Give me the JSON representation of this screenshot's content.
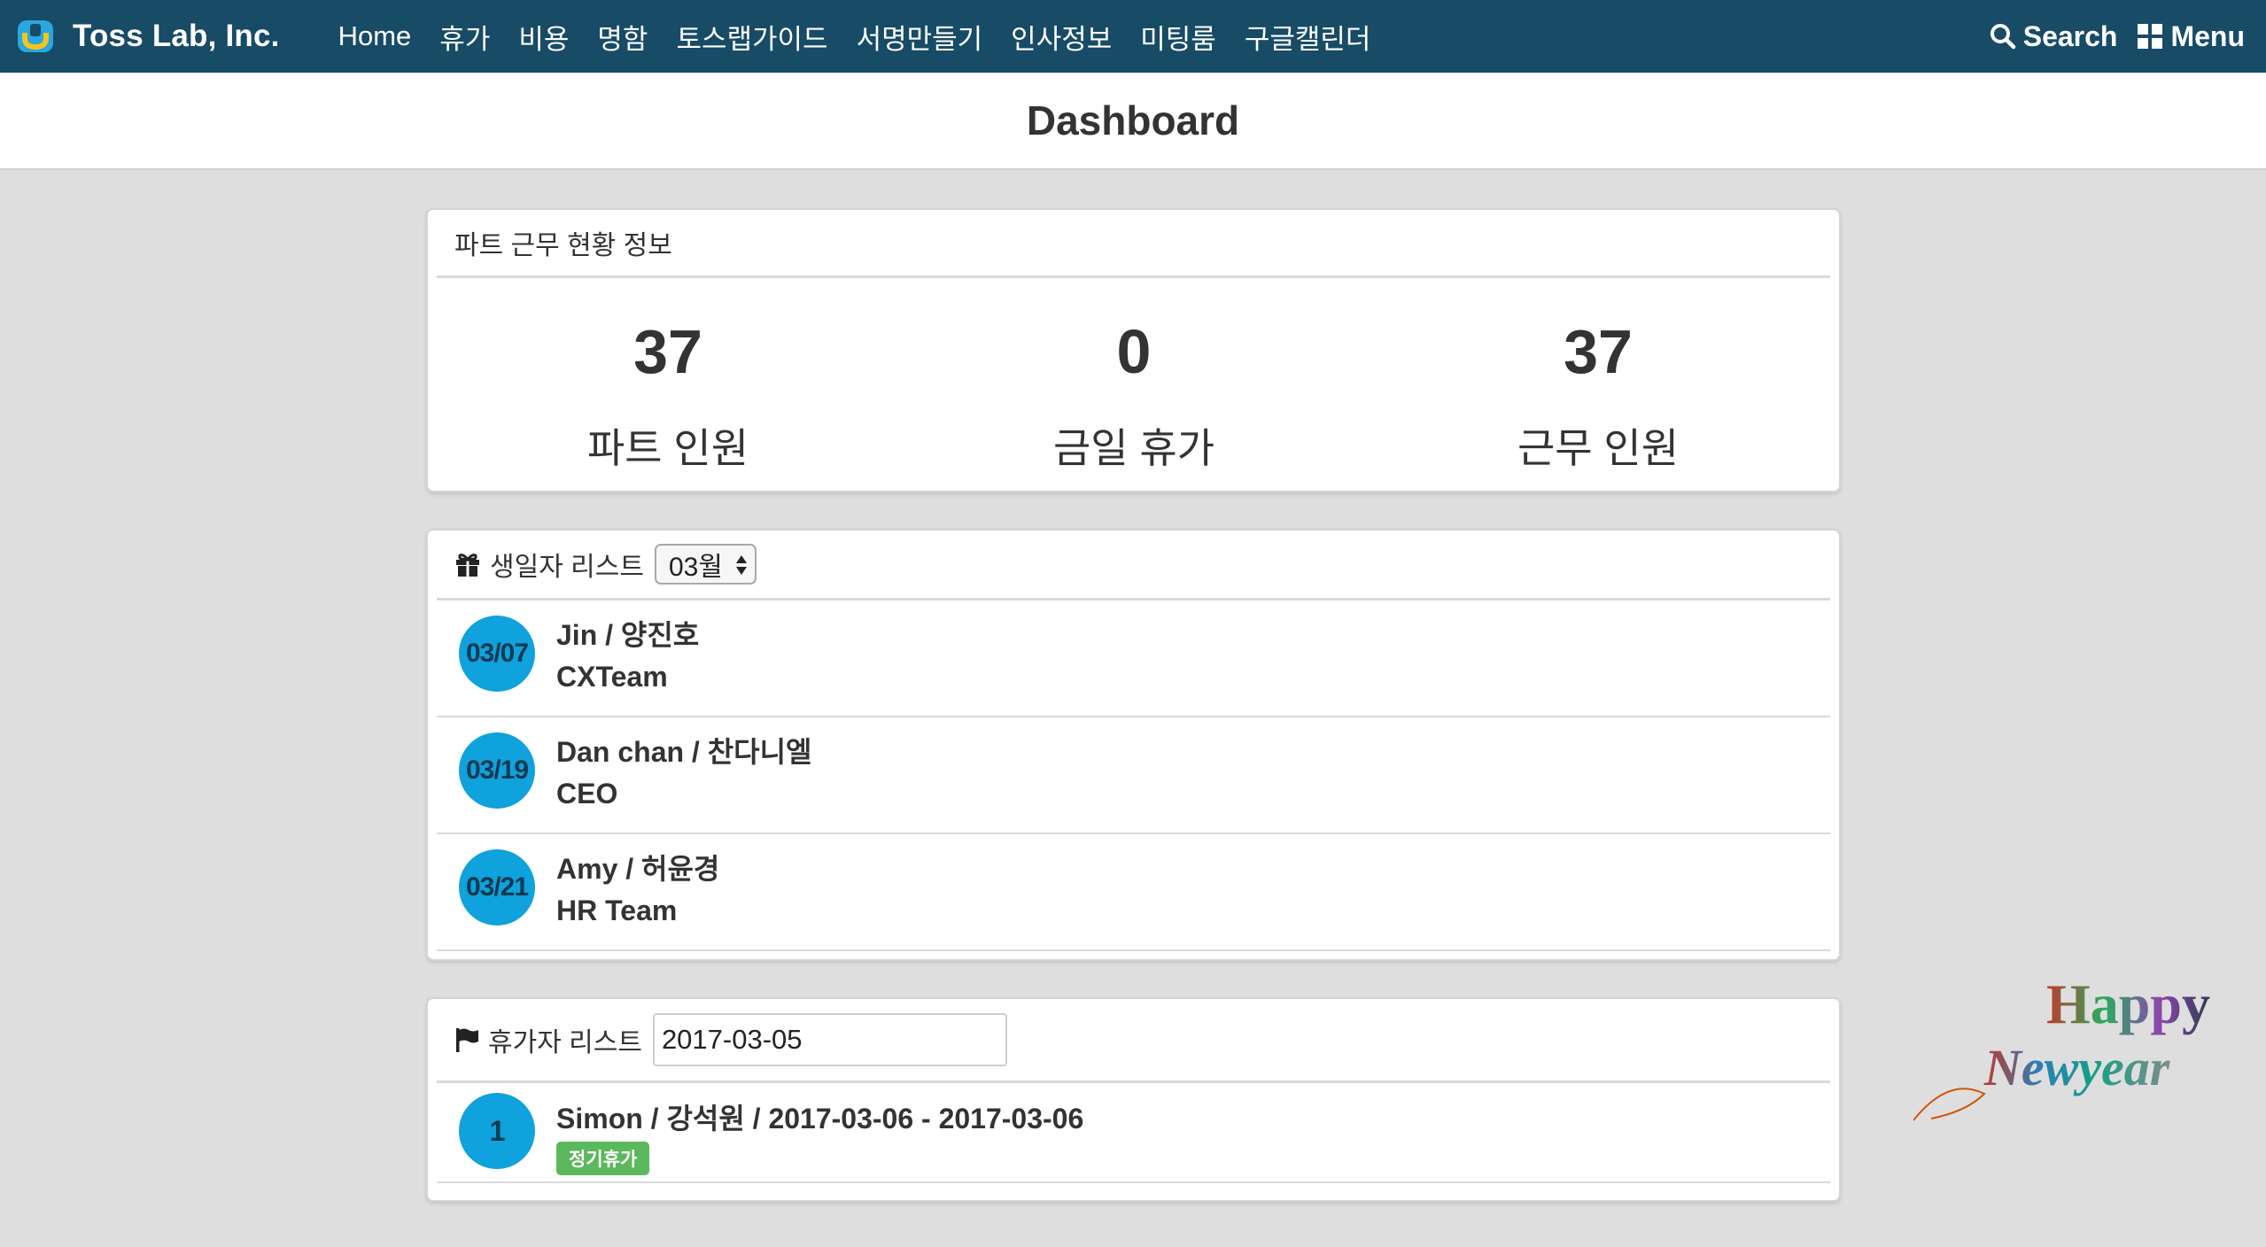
{
  "navbar": {
    "brand": "Toss Lab, Inc.",
    "links": [
      "Home",
      "휴가",
      "비용",
      "명함",
      "토스랩가이드",
      "서명만들기",
      "인사정보",
      "미팅룸",
      "구글캘린더"
    ],
    "search_label": "Search",
    "menu_label": "Menu",
    "icons": {
      "search": "search-icon",
      "menu": "grid-menu-icon",
      "logo": "brand-logo-icon"
    },
    "background_color": "#174b66"
  },
  "page": {
    "title": "Dashboard"
  },
  "stats_panel": {
    "heading": "파트 근무 현황 정보",
    "stats": [
      {
        "value": "37",
        "label": "파트 인원"
      },
      {
        "value": "0",
        "label": "금일 휴가"
      },
      {
        "value": "37",
        "label": "근무 인원"
      }
    ]
  },
  "birthday_panel": {
    "heading": "생일자 리스트",
    "icon": "gift-icon",
    "selected_month": "03월",
    "items": [
      {
        "date": "03/07",
        "name": "Jin / 양진호",
        "team": "CXTeam"
      },
      {
        "date": "03/19",
        "name": "Dan chan / 찬다니엘",
        "team": "CEO"
      },
      {
        "date": "03/21",
        "name": "Amy / 허윤경",
        "team": "HR Team"
      }
    ],
    "circle_color": "#0fa2dc"
  },
  "vacation_panel": {
    "heading": "휴가자 리스트",
    "icon": "flag-icon",
    "date_value": "2017-03-05",
    "items": [
      {
        "index": "1",
        "text": "Simon / 강석원 / 2017-03-06 - 2017-03-06",
        "badge": "정기휴가"
      }
    ],
    "badge_color": "#5cb85c"
  },
  "decoration": {
    "line1": "Happy",
    "line2": "Newyear"
  }
}
